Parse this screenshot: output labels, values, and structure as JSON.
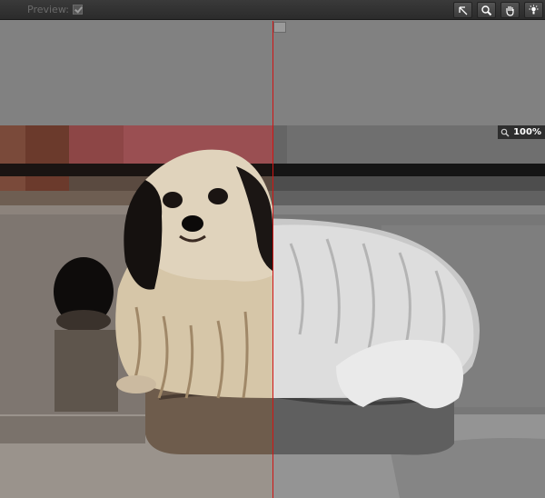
{
  "toolbar": {
    "preview_label": "Preview:",
    "preview_checked": true,
    "tools": [
      {
        "name": "arrow-tool",
        "icon": "arrow-icon"
      },
      {
        "name": "zoom-tool",
        "icon": "magnifier-icon"
      },
      {
        "name": "hand-tool",
        "icon": "hand-icon"
      },
      {
        "name": "light-tool",
        "icon": "light-bulb-icon"
      }
    ]
  },
  "viewer": {
    "zoom_label": "100%",
    "split_color": "#d01515",
    "canvas_color": "#808080"
  }
}
